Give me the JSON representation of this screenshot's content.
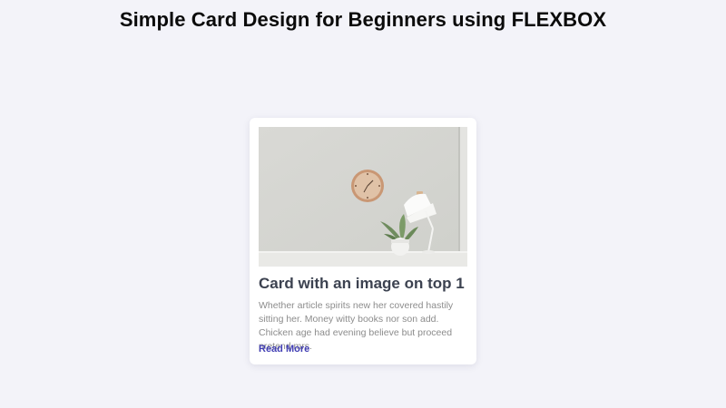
{
  "header": {
    "title": "Simple Card Design for Beginners using FLEXBOX"
  },
  "card": {
    "title": "Card with an image on top 1",
    "description": "Whether article spirits new her covered hastily sitting her. Money witty books nor son add. Chicken age had evening believe but proceed pretend mrs.",
    "link_label": "Read More"
  },
  "colors": {
    "page_background": "#f3f3f9",
    "card_background": "#ffffff",
    "title_text": "#3c4250",
    "body_text": "#8c8c8c",
    "link": "#4340b5"
  }
}
